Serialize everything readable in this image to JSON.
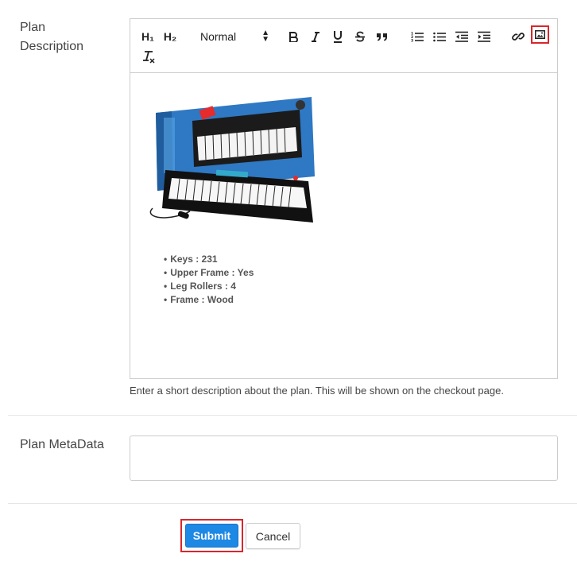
{
  "plan_description": {
    "label_line1": "Plan",
    "label_line2": "Description",
    "toolbar": {
      "h1": "H₁",
      "h2": "H₂",
      "format_select": "Normal",
      "icons": [
        "bold-icon",
        "italic-icon",
        "underline-icon",
        "strikethrough-icon",
        "blockquote-icon",
        "ordered-list-icon",
        "bullet-list-icon",
        "outdent-icon",
        "indent-icon",
        "link-icon",
        "image-icon",
        "clear-format-icon"
      ]
    },
    "content": {
      "image": "keyboard-product-photo",
      "specs": [
        "Keys : 231",
        "Upper Frame : Yes",
        "Leg Rollers : 4",
        "Frame : Wood"
      ]
    },
    "hint": "Enter a short description about the plan. This will be shown on the checkout page."
  },
  "plan_metadata": {
    "label": "Plan MetaData",
    "value": ""
  },
  "actions": {
    "submit": "Submit",
    "cancel": "Cancel"
  },
  "colors": {
    "highlight_border": "#d9262c",
    "submit_bg": "#1e88e5"
  }
}
